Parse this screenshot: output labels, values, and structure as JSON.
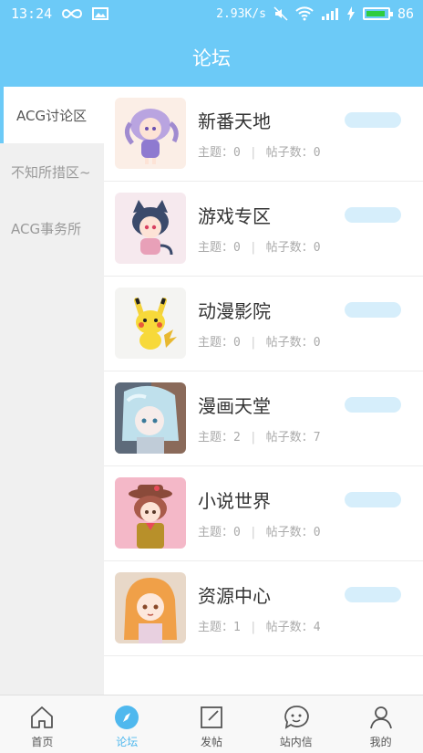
{
  "status_bar": {
    "time": "13:24",
    "network_speed": "2.93K/s",
    "battery": "86"
  },
  "header": {
    "title": "论坛"
  },
  "sidebar": {
    "items": [
      {
        "label": "ACG讨论区",
        "active": true
      },
      {
        "label": "不知所措区~",
        "active": false
      },
      {
        "label": "ACG事务所",
        "active": false
      }
    ]
  },
  "forums": [
    {
      "name": "新番天地",
      "topics_label": "主题：",
      "topics": "0",
      "posts_label": "帖子数：",
      "posts": "0",
      "avatar": "purple-hair-chibi"
    },
    {
      "name": "游戏专区",
      "topics_label": "主题：",
      "topics": "0",
      "posts_label": "帖子数：",
      "posts": "0",
      "avatar": "catgirl-chibi"
    },
    {
      "name": "动漫影院",
      "topics_label": "主题：",
      "topics": "0",
      "posts_label": "帖子数：",
      "posts": "0",
      "avatar": "pikachu"
    },
    {
      "name": "漫画天堂",
      "topics_label": "主题：",
      "topics": "2",
      "posts_label": "帖子数：",
      "posts": "7",
      "avatar": "blue-hair-girl"
    },
    {
      "name": "小说世界",
      "topics_label": "主题：",
      "topics": "0",
      "posts_label": "帖子数：",
      "posts": "0",
      "avatar": "red-hair-girl-hat"
    },
    {
      "name": "资源中心",
      "topics_label": "主题：",
      "topics": "1",
      "posts_label": "帖子数：",
      "posts": "4",
      "avatar": "orange-hair-girl"
    }
  ],
  "tabbar": {
    "items": [
      {
        "label": "首页",
        "icon": "home-icon",
        "active": false
      },
      {
        "label": "论坛",
        "icon": "compass-icon",
        "active": true
      },
      {
        "label": "发帖",
        "icon": "edit-icon",
        "active": false
      },
      {
        "label": "站内信",
        "icon": "message-face-icon",
        "active": false
      },
      {
        "label": "我的",
        "icon": "user-icon",
        "active": false
      }
    ]
  },
  "colors": {
    "primary": "#6ccaf7",
    "tab_active": "#4fb8ee",
    "pill": "#d6eefb"
  }
}
